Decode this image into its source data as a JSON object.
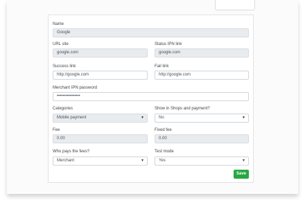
{
  "form": {
    "name": {
      "label": "Name",
      "value": "Google"
    },
    "url_site": {
      "label": "URL site",
      "value": "google.com"
    },
    "status_ipn_link": {
      "label": "Status IPN link",
      "value": "google.com"
    },
    "success_link": {
      "label": "Success link",
      "value": "http://google.com"
    },
    "fail_link": {
      "label": "Fail link",
      "value": "http://google.com"
    },
    "merchant_ipn_password": {
      "label": "Merchant IPN password",
      "value": "••••••••••••••••"
    },
    "categories": {
      "label": "Categories",
      "value": "Mobile payment"
    },
    "show_in_shops": {
      "label": "Show in Shops and payment?",
      "value": "No"
    },
    "fee": {
      "label": "Fee",
      "value": "0.00"
    },
    "fixed_fee": {
      "label": "Fixed fee",
      "value": "0.00"
    },
    "who_pays": {
      "label": "Who pays the fees?",
      "value": "Merchant"
    },
    "test_mode": {
      "label": "Test mode",
      "value": "Yes"
    },
    "save_label": "Save"
  },
  "icons": {
    "select_caret": "caret-down-icon"
  },
  "colors": {
    "save_button": "#28a745",
    "readonly_bg": "#e9ecef"
  }
}
